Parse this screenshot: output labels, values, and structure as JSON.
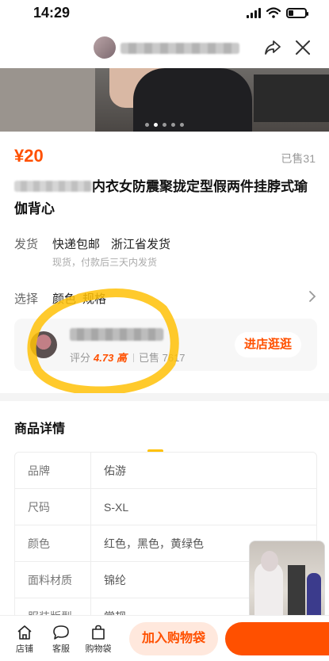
{
  "status_bar": {
    "time": "14:29",
    "battery_level": 0.3
  },
  "nav": {
    "shop_name": "",
    "share_icon": "share-icon",
    "close_icon": "close-icon"
  },
  "gallery": {
    "image_count": 5,
    "active_index": 1
  },
  "product": {
    "price": "¥20",
    "sold": "已售31",
    "title_visible": "内衣女防震聚拢定型假两件挂脖式瑜伽背心"
  },
  "shipping": {
    "label": "发货",
    "options": [
      "快递包邮",
      "浙江省发货"
    ],
    "note": "现货，付款后三天内发货"
  },
  "selection": {
    "label": "选择",
    "options": [
      "颜色",
      "规格"
    ]
  },
  "shop": {
    "rating_label": "评分",
    "rating_value": "4.73",
    "rating_level": "高",
    "sold_label": "已售",
    "sold_value": "7617",
    "enter_label": "进店逛逛"
  },
  "details": {
    "title": "商品详情",
    "specs": [
      {
        "key": "品牌",
        "value": "佑游"
      },
      {
        "key": "尺码",
        "value": "S-XL"
      },
      {
        "key": "颜色",
        "value": "红色，黑色，黄绿色"
      },
      {
        "key": "面料材质",
        "value": "锦纶"
      },
      {
        "key": "服装版型",
        "value": "常规"
      }
    ]
  },
  "bottom_bar": {
    "tabs": [
      {
        "label": "店铺",
        "icon": "shop-icon"
      },
      {
        "label": "客服",
        "icon": "chat-icon"
      },
      {
        "label": "购物袋",
        "icon": "bag-icon"
      }
    ],
    "add_to_cart": "加入购物袋",
    "buy_now": ""
  },
  "colors": {
    "accent": "#ff5000",
    "highlight_marker": "#ffc107"
  }
}
